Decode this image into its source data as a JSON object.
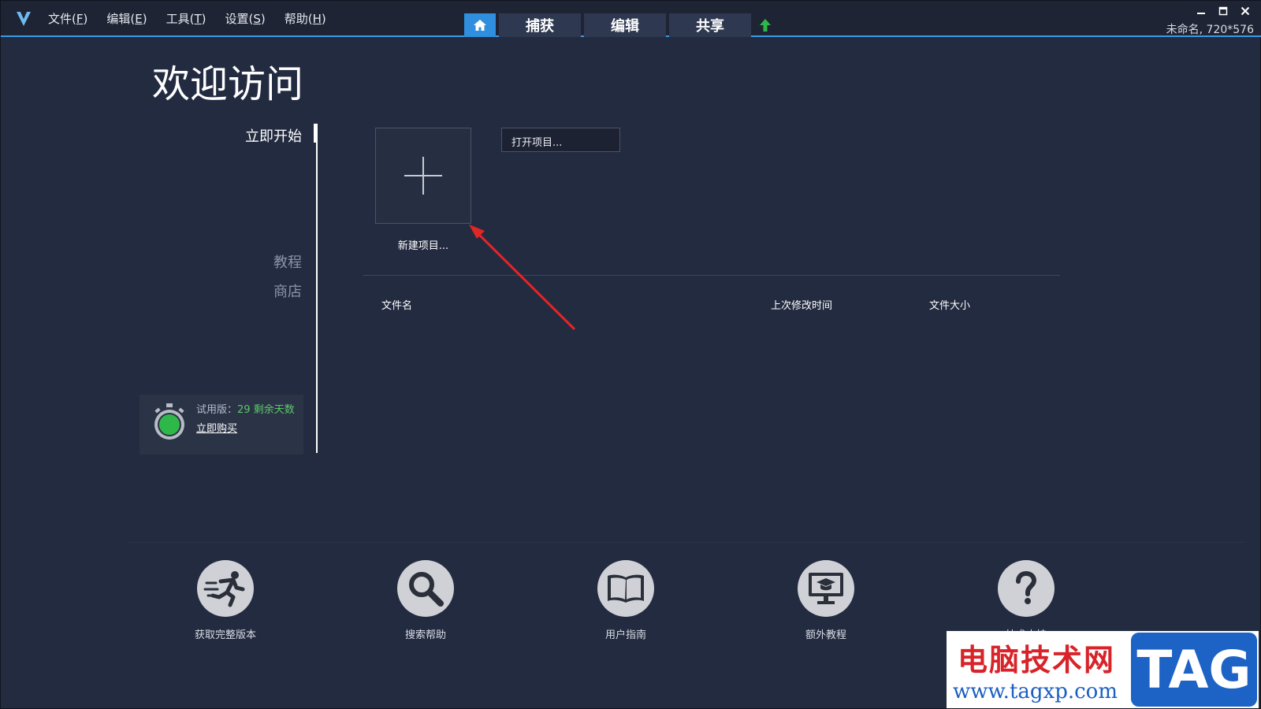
{
  "titlebar": {
    "menu": [
      {
        "label": "文件",
        "key": "F"
      },
      {
        "label": "编辑",
        "key": "E"
      },
      {
        "label": "工具",
        "key": "T"
      },
      {
        "label": "设置",
        "key": "S"
      },
      {
        "label": "帮助",
        "key": "H"
      }
    ],
    "tabs": [
      "捕获",
      "编辑",
      "共享"
    ],
    "project_info": "未命名, 720*576",
    "accent": "#2f8fde"
  },
  "welcome": {
    "title": "欢迎访问"
  },
  "nav": {
    "items": [
      "立即开始",
      "教程",
      "商店"
    ]
  },
  "trial": {
    "prefix": "试用版",
    "days": "29 剩余天数",
    "buy": "立即购买",
    "days_color": "#5cc86a"
  },
  "projects": {
    "new_label": "新建项目...",
    "open_label": "打开项目...",
    "columns": [
      "文件名",
      "上次修改时间",
      "文件大小"
    ]
  },
  "bottom": {
    "items": [
      {
        "label": "获取完整版本",
        "icon": "running-man-icon"
      },
      {
        "label": "搜索帮助",
        "icon": "magnifier-icon"
      },
      {
        "label": "用户指南",
        "icon": "book-icon"
      },
      {
        "label": "额外教程",
        "icon": "monitor-graduation-icon"
      },
      {
        "label": "技术支持",
        "icon": "question-icon"
      }
    ]
  },
  "watermark": {
    "cn": "电脑技术网",
    "url": "www.tagxp.com",
    "tag": "TAG"
  }
}
